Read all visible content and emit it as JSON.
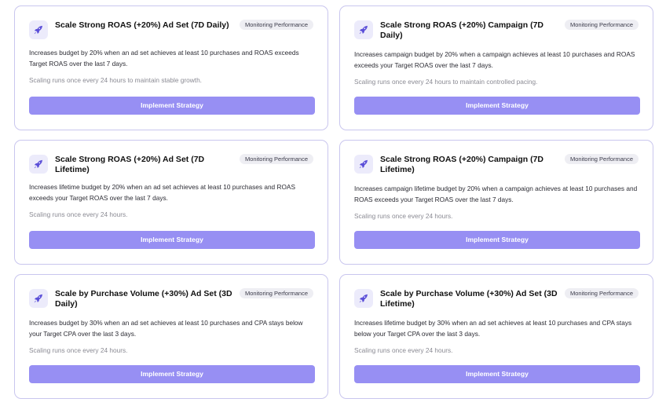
{
  "cards": [
    {
      "title": "Scale Strong ROAS (+20%) Ad Set (7D Daily)",
      "badge": "Monitoring Performance",
      "description": "Increases budget by 20% when an ad set achieves at least 10 purchases and ROAS exceeds Target ROAS over the last 7 days.",
      "note": "Scaling runs once every 24 hours to maintain stable growth.",
      "button": "Implement Strategy",
      "icon": "rocket-icon"
    },
    {
      "title": "Scale Strong ROAS (+20%) Campaign (7D Daily)",
      "badge": "Monitoring Performance",
      "description": "Increases campaign budget by 20% when a campaign achieves at least 10 purchases and ROAS exceeds your Target ROAS over the last 7 days.",
      "note": "Scaling runs once every 24 hours to maintain controlled pacing.",
      "button": "Implement Strategy",
      "icon": "rocket-icon"
    },
    {
      "title": "Scale Strong ROAS (+20%) Ad Set (7D Lifetime)",
      "badge": "Monitoring Performance",
      "description": "Increases lifetime budget by 20% when an ad set achieves at least 10 purchases and ROAS exceeds your Target ROAS over the last 7 days.",
      "note": "Scaling runs once every 24 hours.",
      "button": "Implement Strategy",
      "icon": "rocket-icon"
    },
    {
      "title": "Scale Strong ROAS (+20%) Campaign (7D Lifetime)",
      "badge": "Monitoring Performance",
      "description": "Increases campaign lifetime budget by 20% when a campaign achieves at least 10 purchases and ROAS exceeds your Target ROAS over the last 7 days.",
      "note": "Scaling runs once every 24 hours.",
      "button": "Implement Strategy",
      "icon": "rocket-icon"
    },
    {
      "title": "Scale by Purchase Volume (+30%) Ad Set (3D Daily)",
      "badge": "Monitoring Performance",
      "description": "Increases budget by 30% when an ad set achieves at least 10 purchases and CPA stays below your Target CPA over the last 3 days.",
      "note": "Scaling runs once every 24 hours.",
      "button": "Implement Strategy",
      "icon": "rocket-icon"
    },
    {
      "title": "Scale by Purchase Volume (+30%) Ad Set (3D Lifetime)",
      "badge": "Monitoring Performance",
      "description": "Increases lifetime budget by 30% when an ad set achieves at least 10 purchases and CPA stays below your Target CPA over the last 3 days.",
      "note": "Scaling runs once every 24 hours.",
      "button": "Implement Strategy",
      "icon": "rocket-icon"
    }
  ],
  "colors": {
    "accent": "#978ff3",
    "card_border": "#c9c6ee",
    "icon_bg": "#ecebfb",
    "badge_bg": "#eeeef3"
  }
}
